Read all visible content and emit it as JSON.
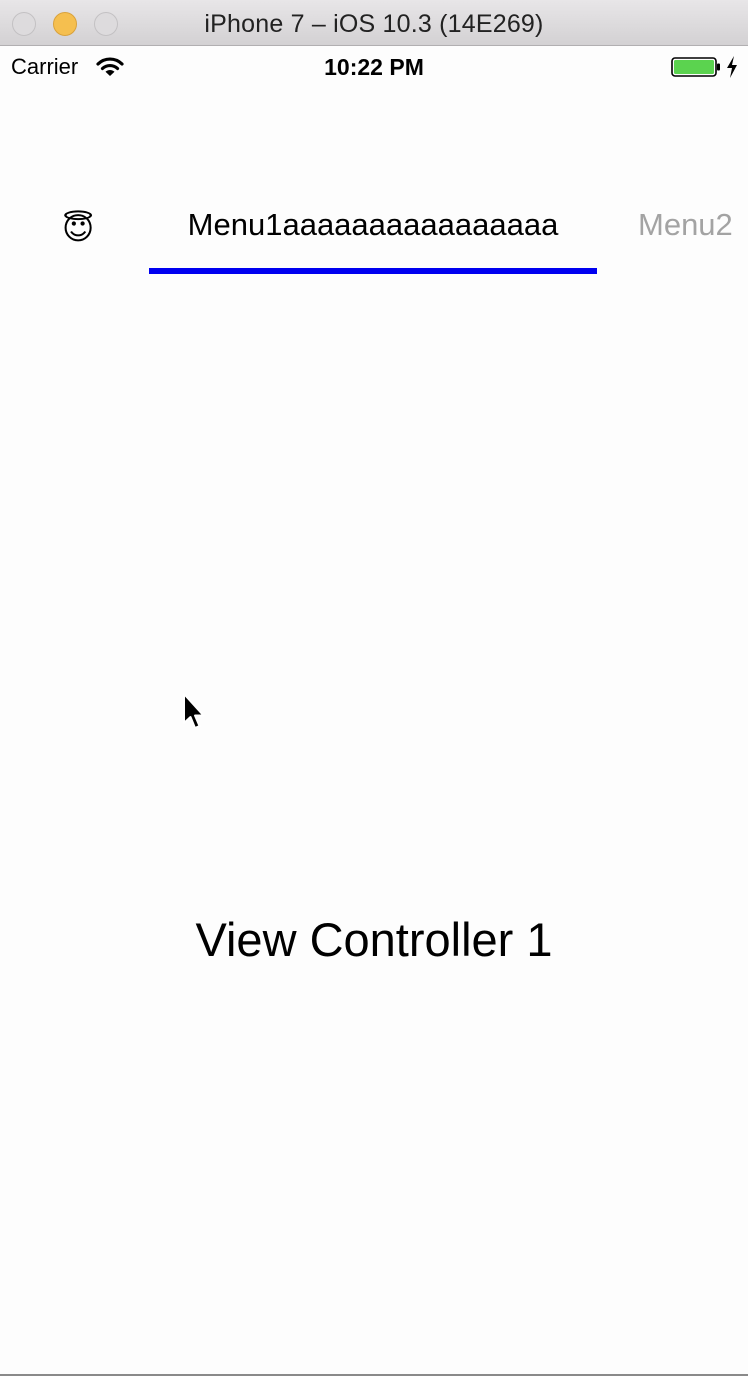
{
  "window": {
    "title": "iPhone 7 – iOS 10.3 (14E269)",
    "controls": [
      "close-icon",
      "minimize-icon",
      "zoom-icon"
    ]
  },
  "status_bar": {
    "carrier": "Carrier",
    "time": "10:22 PM",
    "icons": [
      "wifi-icon",
      "battery-icon",
      "charging-bolt-icon"
    ],
    "battery_level": 1.0,
    "battery_color": "#5bd34f"
  },
  "menu": {
    "items": [
      {
        "label": "😇",
        "selected": false
      },
      {
        "label": "Menu1aaaaaaaaaaaaaaaa",
        "selected": true
      },
      {
        "label": "Menu2",
        "selected": false
      }
    ],
    "indicator_color": "#0000f0",
    "selected_text_color": "#000000",
    "unselected_text_color": "#a3a3a3"
  },
  "content": {
    "label": "View Controller 1"
  }
}
